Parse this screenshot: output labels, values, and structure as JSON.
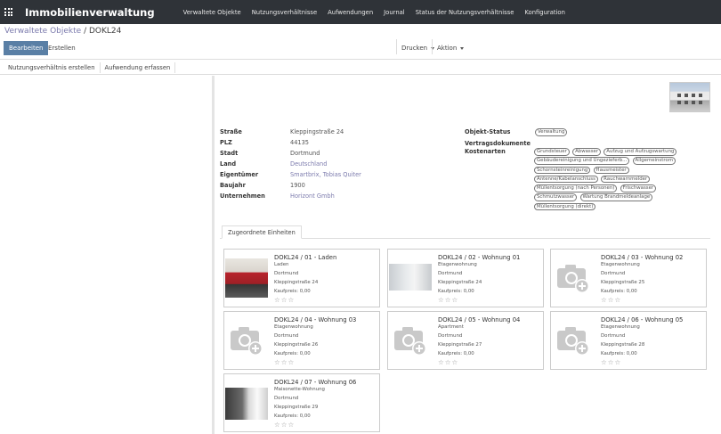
{
  "app": {
    "title": "Immobilienverwaltung",
    "menu": [
      "Verwaltete Objekte",
      "Nutzungsverhältnisse",
      "Aufwendungen",
      "Journal",
      "Status der Nutzungsverhältnisse",
      "Konfiguration"
    ]
  },
  "breadcrumb": {
    "parent": "Verwaltete Objekte",
    "separator": "/",
    "current": "DOKL24"
  },
  "toolbar": {
    "edit_label": "Bearbeiten",
    "create_label": "Erstellen",
    "print_label": "Drucken",
    "action_label": "Aktion"
  },
  "statusbar": {
    "buttons": [
      "Nutzungsverhältnis erstellen",
      "Aufwendung erfassen"
    ]
  },
  "fields": {
    "left": [
      {
        "label": "Straße",
        "value": "Kleppingstraße 24"
      },
      {
        "label": "PLZ",
        "value": "44135"
      },
      {
        "label": "Stadt",
        "value": "Dortmund"
      },
      {
        "label": "Land",
        "value": "Deutschland"
      },
      {
        "label": "Eigentümer",
        "value": "Smartbrix, Tobias Quiter"
      },
      {
        "label": "Baujahr",
        "value": "1900"
      },
      {
        "label": "Unternehmen",
        "value": "Horizont Gmbh"
      }
    ],
    "right": {
      "status_label": "Objekt-Status",
      "status_value": "Verwaltung",
      "contracts_label": "Vertragsdokumente",
      "cost_label": "Kostenarten",
      "cost_tags": [
        "Grundsteuer",
        "Abwasser",
        "Aufzug und Aufzugswartung",
        "Gebäudereinigung und Ungezieferb...",
        "Allgemeinstrom",
        "Schornsteinreinigung",
        "Hausmeister",
        "Antenne/Kabelanschluss",
        "Rauchwarnmelder",
        "Müllentsorgung (nach Personen)",
        "Frischwasser",
        "Schmutzwasser",
        "Wartung Brandmeldeanlage",
        "Müllentsorgung (direkt)"
      ]
    }
  },
  "tabs": {
    "units_label": "Zugeordnete Einheiten"
  },
  "units": [
    {
      "title": "DOKL24 / 01 - Laden",
      "type": "Laden",
      "city": "Dortmund",
      "street": "Kleppingstraße 24",
      "price": "Kaufpreis: 0,00",
      "stars": "☆☆☆",
      "image": "photo1"
    },
    {
      "title": "DOKL24 / 02 - Wohnung 01",
      "type": "Etagenwohnung",
      "city": "Dortmund",
      "street": "Kleppingstraße 24",
      "price": "Kaufpreis: 0,00",
      "stars": "☆☆☆",
      "image": "photo2"
    },
    {
      "title": "DOKL24 / 03 - Wohnung 02",
      "type": "Etagenwohnung",
      "city": "Dortmund",
      "street": "Kleppingstraße 25",
      "price": "Kaufpreis: 0,00",
      "stars": "☆☆☆",
      "image": "camera"
    },
    {
      "title": "DOKL24 / 04 - Wohnung 03",
      "type": "Etagenwohnung",
      "city": "Dortmund",
      "street": "Kleppingstraße 26",
      "price": "Kaufpreis: 0,00",
      "stars": "☆☆☆",
      "image": "camera"
    },
    {
      "title": "DOKL24 / 05 - Wohnung 04",
      "type": "Apartment",
      "city": "Dortmund",
      "street": "Kleppingstraße 27",
      "price": "Kaufpreis: 0,00",
      "stars": "☆☆☆",
      "image": "camera"
    },
    {
      "title": "DOKL24 / 06 - Wohnung 05",
      "type": "Etagenwohnung",
      "city": "Dortmund",
      "street": "Kleppingstraße 28",
      "price": "Kaufpreis: 0,00",
      "stars": "☆☆☆",
      "image": "camera"
    },
    {
      "title": "DOKL24 / 07 - Wohnung 06",
      "type": "Maisonette-Wohnung",
      "city": "Dortmund",
      "street": "Kleppingstraße 29",
      "price": "Kaufpreis: 0,00",
      "stars": "☆☆☆",
      "image": "photo7"
    }
  ],
  "colors": {
    "navbar": "#2f3338",
    "primary_button": "#5a7fa5",
    "link": "#7c7bad"
  }
}
